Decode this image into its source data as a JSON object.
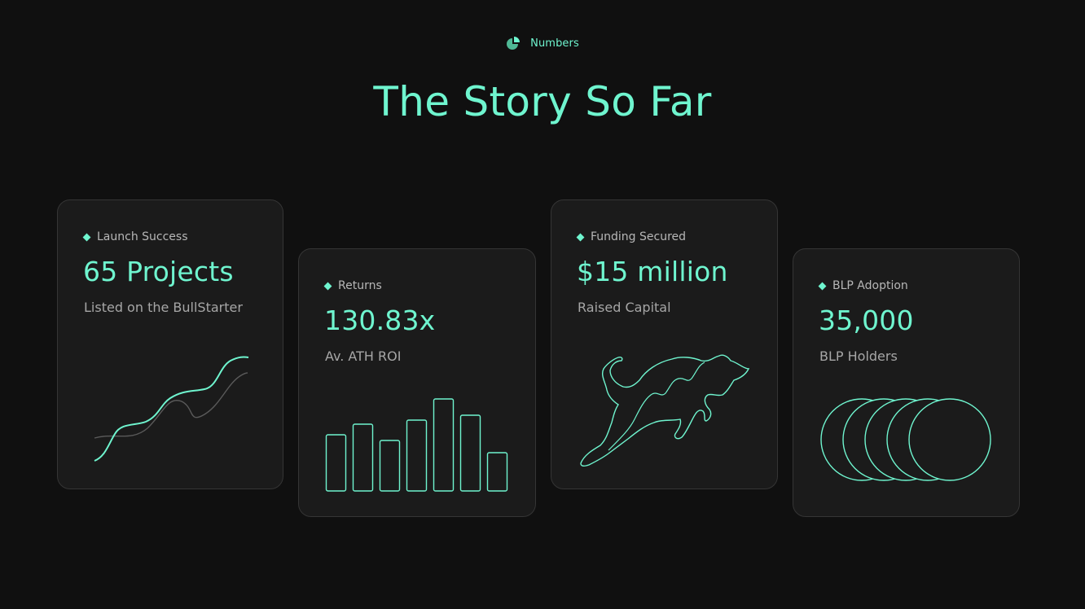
{
  "header": {
    "eyebrow": "Numbers",
    "eyebrow_icon": "pie-chart-icon",
    "title": "The Story So Far"
  },
  "colors": {
    "accent": "#6ff5cf",
    "background": "#101010",
    "card": "#1b1b1b",
    "card_border": "#353535",
    "muted_text": "#a6a6a6"
  },
  "cards": [
    {
      "tag": "Launch Success",
      "value": "65 Projects",
      "subtitle": "Listed on the BullStarter",
      "illustration": "wave-line-icon"
    },
    {
      "tag": "Returns",
      "value": "130.83x",
      "subtitle": "Av. ATH ROI",
      "illustration": "bar-chart-icon"
    },
    {
      "tag": "Funding Secured",
      "value": "$15 million",
      "subtitle": "Raised Capital",
      "illustration": "bull-icon"
    },
    {
      "tag": "BLP Adoption",
      "value": "35,000",
      "subtitle": "BLP Holders",
      "illustration": "overlapping-circles-icon"
    }
  ]
}
